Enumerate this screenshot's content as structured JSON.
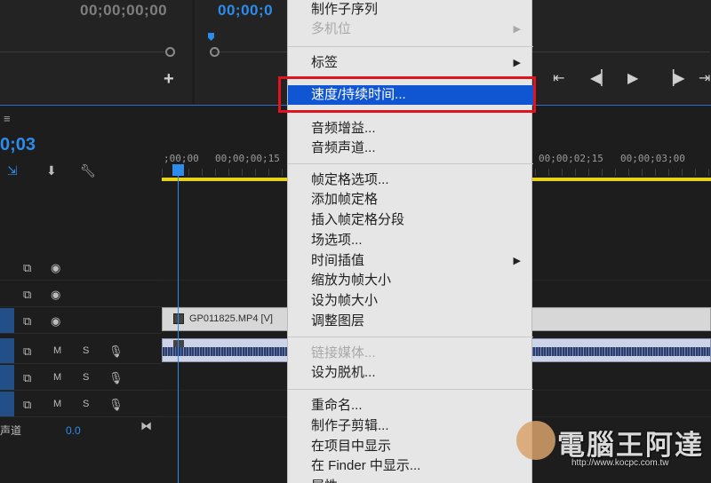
{
  "monitors": {
    "source_timecode": "00;00;00;00",
    "program_timecode": "00;00;0"
  },
  "timeline": {
    "sequence_timecode": "0;03",
    "ruler_labels": [
      ";00;00",
      "00;00;00;15",
      "00;00;02;15",
      "00;00;03;00"
    ],
    "tracks": [
      {
        "type": "video",
        "selected": false
      },
      {
        "type": "video",
        "selected": false
      },
      {
        "type": "video",
        "selected": true
      },
      {
        "type": "audio",
        "selected": true,
        "mute": "M",
        "solo": "S"
      },
      {
        "type": "audio",
        "selected": true,
        "mute": "M",
        "solo": "S"
      },
      {
        "type": "audio",
        "selected": true,
        "mute": "M",
        "solo": "S"
      }
    ],
    "master_label": "声道",
    "master_value": "0.0",
    "video_clip_label": "GP011825.MP4 [V]"
  },
  "context_menu": {
    "items": [
      {
        "label": "制作子序列",
        "disabled": false,
        "submenu": false
      },
      {
        "label": "多机位",
        "disabled": true,
        "submenu": true
      },
      {
        "label": "标签",
        "disabled": false,
        "submenu": true
      },
      {
        "label": "速度/持续时间...",
        "disabled": false,
        "submenu": false,
        "highlighted": true
      },
      {
        "label": "音频增益...",
        "disabled": false,
        "submenu": false
      },
      {
        "label": "音频声道...",
        "disabled": false,
        "submenu": false
      },
      {
        "label": "帧定格选项...",
        "disabled": false,
        "submenu": false
      },
      {
        "label": "添加帧定格",
        "disabled": false,
        "submenu": false
      },
      {
        "label": "插入帧定格分段",
        "disabled": false,
        "submenu": false
      },
      {
        "label": "场选项...",
        "disabled": false,
        "submenu": false
      },
      {
        "label": "时间插值",
        "disabled": false,
        "submenu": true
      },
      {
        "label": "缩放为帧大小",
        "disabled": false,
        "submenu": false
      },
      {
        "label": "设为帧大小",
        "disabled": false,
        "submenu": false
      },
      {
        "label": "调整图层",
        "disabled": false,
        "submenu": false
      },
      {
        "label": "链接媒体...",
        "disabled": true,
        "submenu": false
      },
      {
        "label": "设为脱机...",
        "disabled": false,
        "submenu": false
      },
      {
        "label": "重命名...",
        "disabled": false,
        "submenu": false
      },
      {
        "label": "制作子剪辑...",
        "disabled": false,
        "submenu": false
      },
      {
        "label": "在项目中显示",
        "disabled": false,
        "submenu": false
      },
      {
        "label": "在 Finder 中显示...",
        "disabled": false,
        "submenu": false
      },
      {
        "label": "属性",
        "disabled": false,
        "submenu": false
      }
    ],
    "submenu_arrow": "▶"
  },
  "watermark": {
    "title": "電腦王阿達",
    "url": "http://www.kocpc.com.tw"
  },
  "colors": {
    "accent_blue": "#2d8ceb",
    "menu_highlight": "#1056d3",
    "annotation_red": "#e0141e",
    "work_area_yellow": "#e7d31c"
  }
}
